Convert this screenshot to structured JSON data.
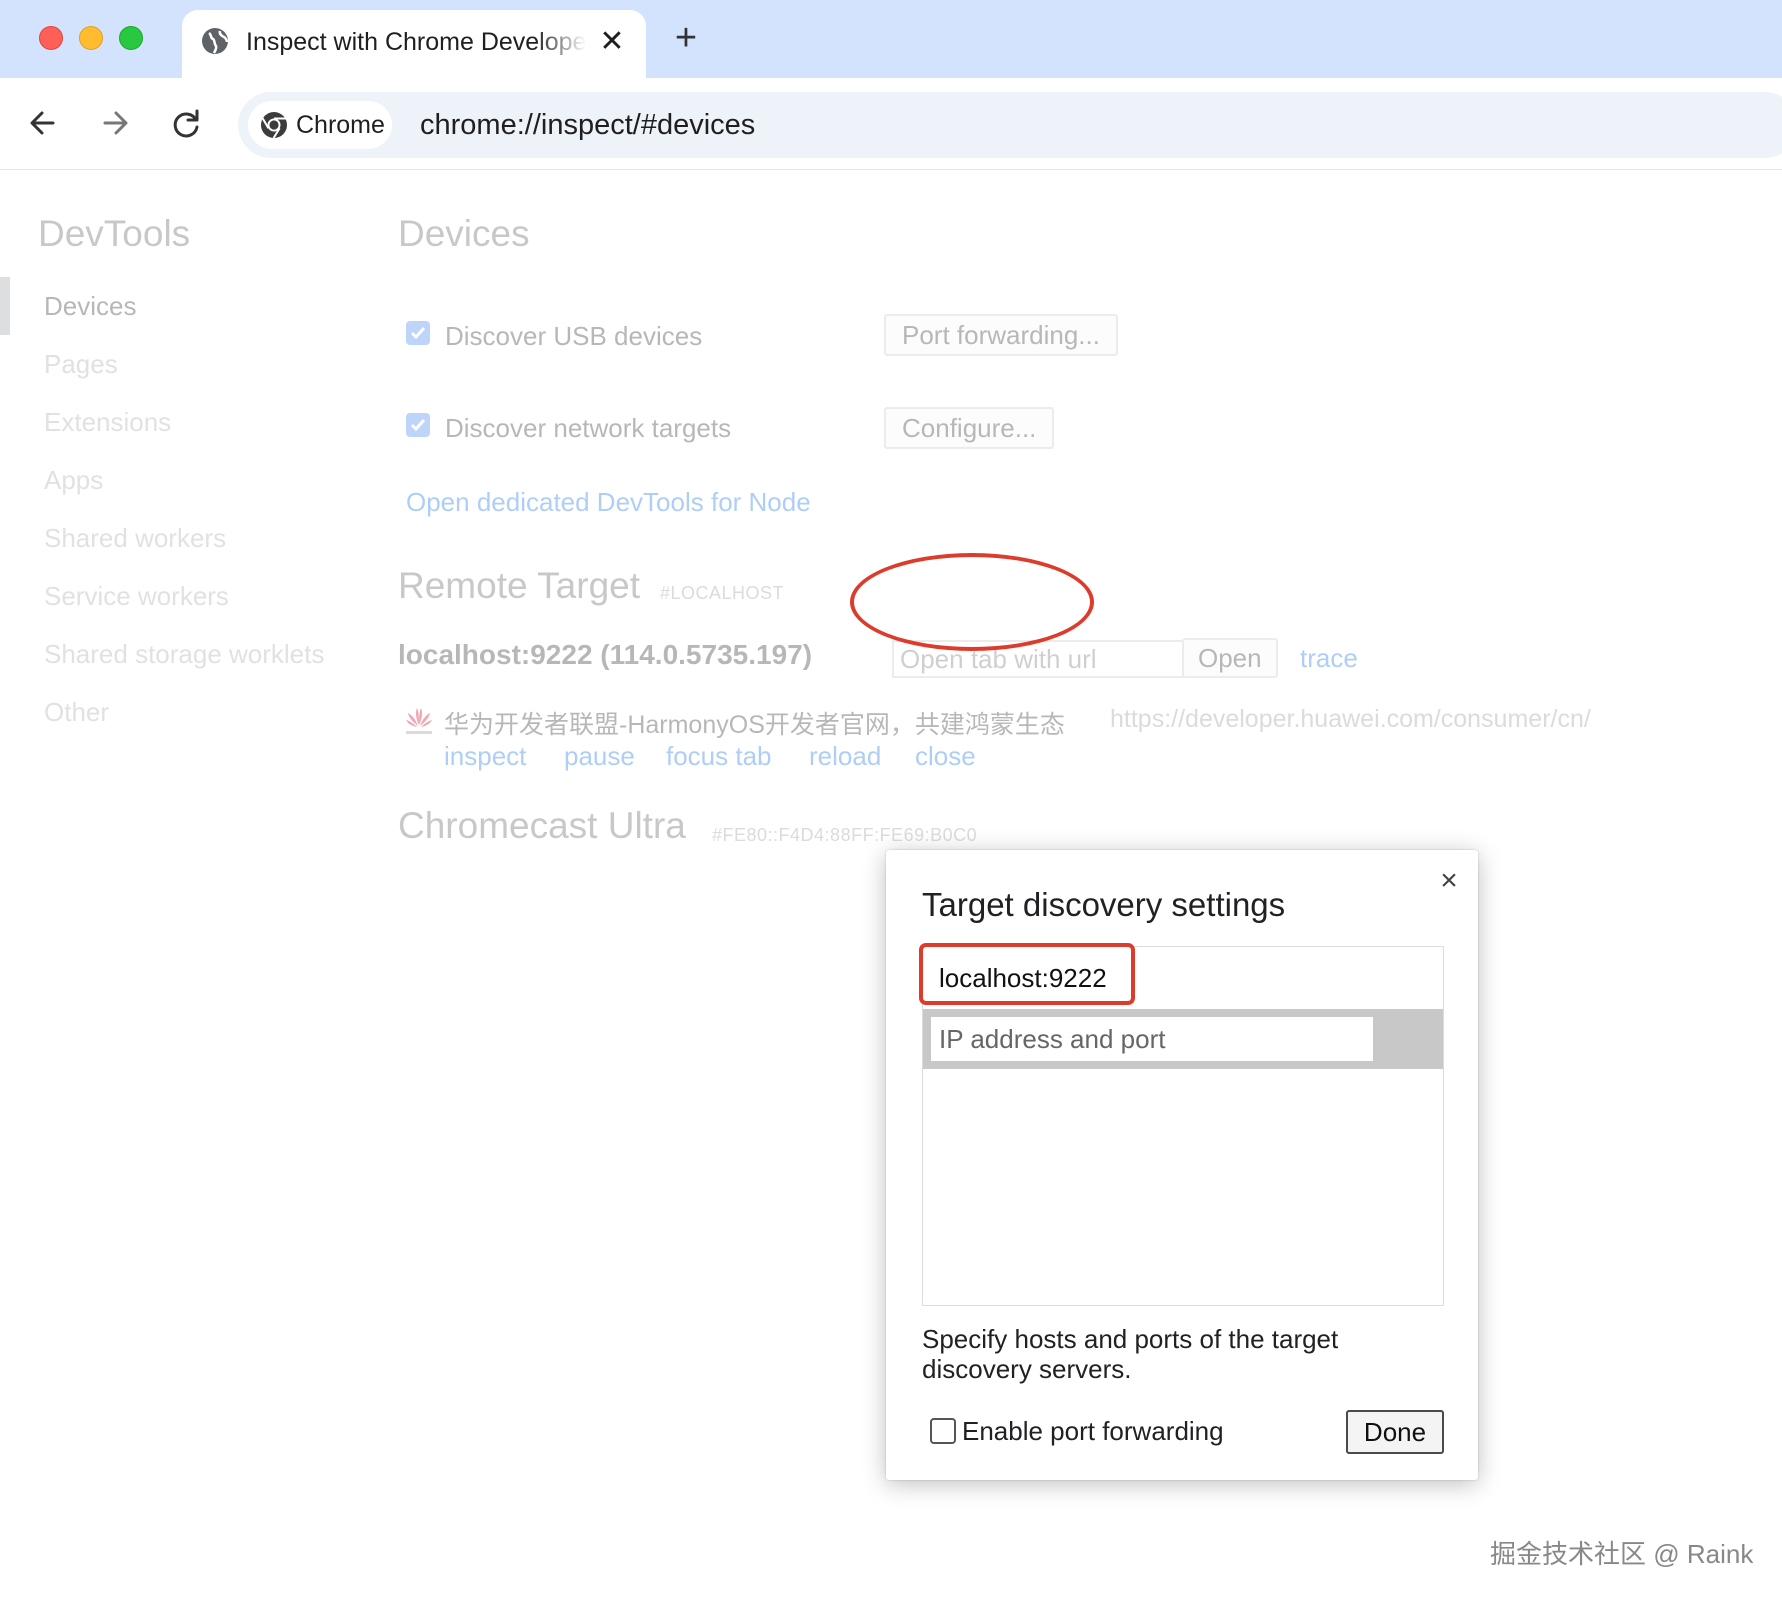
{
  "window": {
    "traffic_colors": {
      "close": "#fe5f57",
      "minimize": "#febc2e",
      "zoom": "#28c840"
    }
  },
  "tab": {
    "title": "Inspect with Chrome Developer Tools",
    "icon": "globe-icon",
    "close_glyph": "✕",
    "new_tab_glyph": "+"
  },
  "toolbar": {
    "chip_label": "Chrome",
    "url": "chrome://inspect/#devices"
  },
  "sidebar": {
    "title": "DevTools",
    "items": [
      {
        "label": "Devices",
        "active": true
      },
      {
        "label": "Pages",
        "active": false
      },
      {
        "label": "Extensions",
        "active": false
      },
      {
        "label": "Apps",
        "active": false
      },
      {
        "label": "Shared workers",
        "active": false
      },
      {
        "label": "Service workers",
        "active": false
      },
      {
        "label": "Shared storage worklets",
        "active": false
      },
      {
        "label": "Other",
        "active": false
      }
    ]
  },
  "main": {
    "title": "Devices",
    "usb": {
      "label": "Discover USB devices",
      "checked": true,
      "button": "Port forwarding..."
    },
    "network": {
      "label": "Discover network targets",
      "checked": true,
      "button": "Configure..."
    },
    "node_link": "Open dedicated DevTools for Node",
    "remote": {
      "title": "Remote Target",
      "subtitle": "#LOCALHOST",
      "host": "localhost:9222 (114.0.5735.197)",
      "url_placeholder": "Open tab with url",
      "open_button": "Open",
      "trace_link": "trace",
      "page": {
        "title": "华为开发者联盟-HarmonyOS开发者官网，共建鸿蒙生态",
        "url": "https://developer.huawei.com/consumer/cn/",
        "actions": [
          "inspect",
          "pause",
          "focus tab",
          "reload",
          "close"
        ]
      }
    },
    "chromecast": {
      "title": "Chromecast Ultra",
      "subtitle": "#FE80::F4D4:88FF:FE69:B0C0"
    }
  },
  "modal": {
    "title": "Target discovery settings",
    "close_glyph": "×",
    "hosts": [
      "localhost:9222"
    ],
    "add_placeholder": "IP address and port",
    "help": "Specify hosts and ports of the target discovery servers.",
    "port_forwarding_label": "Enable port forwarding",
    "port_forwarding_checked": false,
    "done": "Done"
  },
  "annotation_color": "#dd3b2b",
  "watermark": "掘金技术社区 @ Raink"
}
